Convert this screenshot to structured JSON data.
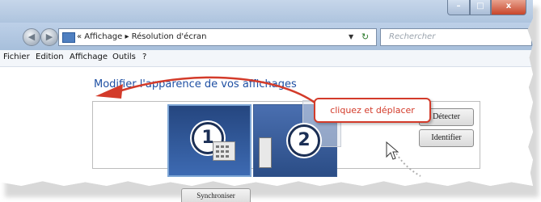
{
  "window": {
    "controls": {
      "minimize": "–",
      "maximize": "□",
      "close": "x"
    }
  },
  "address_bar": {
    "path": "« Affichage ▸ Résolution d'écran",
    "dropdown_icon": "chevron-down-icon",
    "refresh_icon": "refresh-icon"
  },
  "search": {
    "placeholder": "Rechercher"
  },
  "menu": {
    "items": [
      "Fichier",
      "Edition",
      "Affichage",
      "Outils",
      "?"
    ]
  },
  "content": {
    "heading": "Modifier l'apparence de vos affichages",
    "monitors": [
      {
        "number": "1",
        "selected": true
      },
      {
        "number": "2",
        "selected": false
      }
    ],
    "buttons": {
      "detect": "Détecter",
      "identify": "Identifier"
    },
    "annotation": "cliquez et déplacer",
    "bottom_button": "Synchroniser"
  },
  "colors": {
    "accent": "#1e4fa3",
    "annotation": "#d33b2a",
    "monitor_fill": "#2b4d86"
  }
}
